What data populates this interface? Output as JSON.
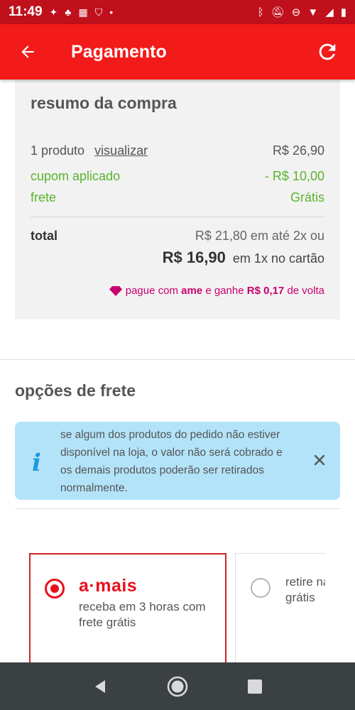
{
  "status_bar": {
    "time": "11:49"
  },
  "app_bar": {
    "title": "Pagamento"
  },
  "summary": {
    "title": "resumo da compra",
    "products_label": "1 produto",
    "view_link": "visualizar",
    "products_value": "R$ 26,90",
    "coupon_label": "cupom aplicado",
    "coupon_value": "- R$ 10,00",
    "shipping_label": "frete",
    "shipping_value": "Grátis",
    "total_label": "total",
    "installments_text": "R$ 21,80 em até 2x ou",
    "single_payment_amount": "R$ 16,90",
    "single_payment_text": "em 1x no cartão",
    "ame": {
      "prefix": "pague com",
      "brand": "ame",
      "middle": "e ganhe",
      "cashback": "R$ 0,17",
      "suffix": "de volta"
    }
  },
  "shipping_options": {
    "title": "opções de frete",
    "info_text": "se algum dos produtos do pedido não estiver disponível na loja, o valor não será cobrado e os demais produtos poderão ser retirados normalmente.",
    "options": [
      {
        "logo": "a·mais",
        "description": "receba em 3 horas com frete grátis",
        "selected": true
      },
      {
        "description": "retire na loja com frete grátis",
        "selected": false
      }
    ]
  },
  "colors": {
    "brand_red": "#f31a1a",
    "status_red": "#c0101c",
    "green": "#5ab42c",
    "ame_pink": "#c8006f",
    "info_blue": "#b3e3f8"
  },
  "icons": [
    "back-arrow-icon",
    "refresh-icon",
    "diamond-icon",
    "info-icon",
    "close-icon",
    "nav-back-icon",
    "nav-home-icon",
    "nav-recents-icon"
  ]
}
